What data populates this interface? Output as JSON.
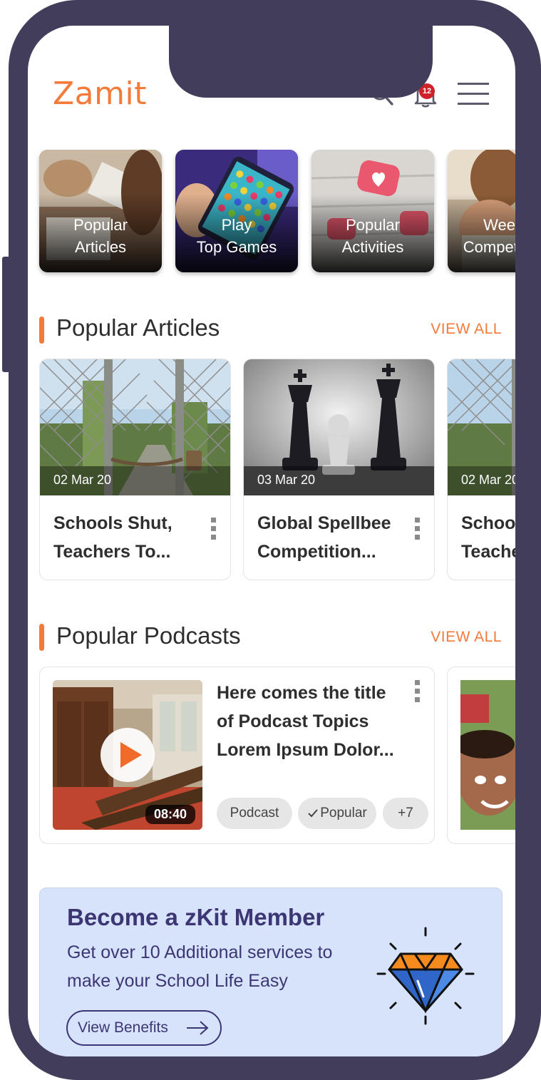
{
  "header": {
    "logo": "Zamit",
    "notification_count": "12",
    "icons": [
      "search-icon",
      "bell-icon",
      "menu-icon"
    ]
  },
  "categories": [
    {
      "label": "Popular\nArticles",
      "icon": "articles-photo"
    },
    {
      "label": "Play\nTop Games",
      "icon": "games-photo"
    },
    {
      "label": "Popular\nActivities",
      "icon": "activities-photo"
    },
    {
      "label": "Weekly\nCompetitions",
      "icon": "competitions-photo"
    }
  ],
  "articles_section": {
    "title": "Popular Articles",
    "view_all": "VIEW ALL",
    "items": [
      {
        "date": "02 Mar 20",
        "title": "Schools Shut, Teachers To..."
      },
      {
        "date": "03 Mar 20",
        "title": "Global Spellbee Competition..."
      },
      {
        "date": "02 Mar 20",
        "title": "Schools Shut, Teachers To..."
      }
    ]
  },
  "podcasts_section": {
    "title": "Popular Podcasts",
    "view_all": "VIEW ALL",
    "item": {
      "title": "Here comes the title of Podcast Topics Lorem Ipsum Dolor...",
      "duration": "08:40",
      "tags": [
        "Podcast",
        "Popular",
        "+7"
      ]
    }
  },
  "member": {
    "title": "Become a zKit Member",
    "description": "Get over 10 Additional services to make your School Life Easy",
    "button": "View Benefits"
  },
  "colors": {
    "accent": "#f47a3a",
    "frame": "#433d5c",
    "member_bg": "#d6e3fb",
    "member_text": "#3c3674"
  }
}
